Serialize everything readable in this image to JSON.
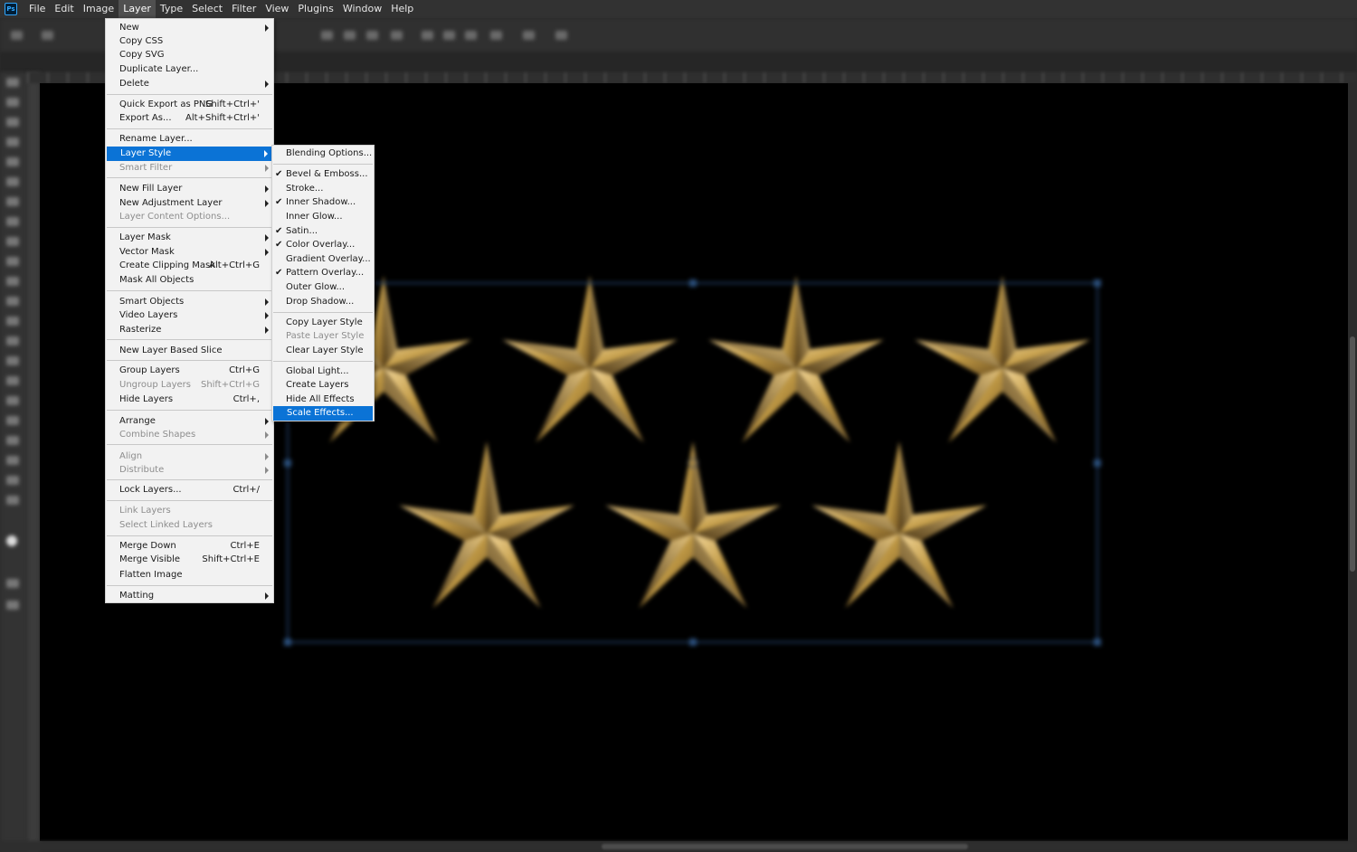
{
  "app": {
    "logo_text": "Ps"
  },
  "menubar": {
    "items": [
      "File",
      "Edit",
      "Image",
      "Layer",
      "Type",
      "Select",
      "Filter",
      "View",
      "Plugins",
      "Window",
      "Help"
    ],
    "active": "Layer"
  },
  "layer_menu": {
    "new": "New",
    "copy_css": "Copy CSS",
    "copy_svg": "Copy SVG",
    "duplicate_layer": "Duplicate Layer...",
    "delete": "Delete",
    "quick_export": "Quick Export as PNG",
    "quick_export_sc": "Shift+Ctrl+'",
    "export_as": "Export As...",
    "export_as_sc": "Alt+Shift+Ctrl+'",
    "rename_layer": "Rename Layer...",
    "layer_style": "Layer Style",
    "smart_filter": "Smart Filter",
    "new_fill_layer": "New Fill Layer",
    "new_adjustment_layer": "New Adjustment Layer",
    "layer_content_options": "Layer Content Options...",
    "layer_mask": "Layer Mask",
    "vector_mask": "Vector Mask",
    "create_clipping_mask": "Create Clipping Mask",
    "create_clipping_mask_sc": "Alt+Ctrl+G",
    "mask_all_objects": "Mask All Objects",
    "smart_objects": "Smart Objects",
    "video_layers": "Video Layers",
    "rasterize": "Rasterize",
    "new_layer_based_slice": "New Layer Based Slice",
    "group_layers": "Group Layers",
    "group_layers_sc": "Ctrl+G",
    "ungroup_layers": "Ungroup Layers",
    "ungroup_layers_sc": "Shift+Ctrl+G",
    "hide_layers": "Hide Layers",
    "hide_layers_sc": "Ctrl+,",
    "arrange": "Arrange",
    "combine_shapes": "Combine Shapes",
    "align": "Align",
    "distribute": "Distribute",
    "lock_layers": "Lock Layers...",
    "lock_layers_sc": "Ctrl+/",
    "link_layers": "Link Layers",
    "select_linked_layers": "Select Linked Layers",
    "merge_down": "Merge Down",
    "merge_down_sc": "Ctrl+E",
    "merge_visible": "Merge Visible",
    "merge_visible_sc": "Shift+Ctrl+E",
    "flatten_image": "Flatten Image",
    "matting": "Matting"
  },
  "layer_style_submenu": {
    "blending_options": "Blending Options...",
    "bevel_emboss": "Bevel & Emboss...",
    "stroke": "Stroke...",
    "inner_shadow": "Inner Shadow...",
    "inner_glow": "Inner Glow...",
    "satin": "Satin...",
    "color_overlay": "Color Overlay...",
    "gradient_overlay": "Gradient Overlay...",
    "pattern_overlay": "Pattern Overlay...",
    "outer_glow": "Outer Glow...",
    "drop_shadow": "Drop Shadow...",
    "copy_layer_style": "Copy Layer Style",
    "paste_layer_style": "Paste Layer Style",
    "clear_layer_style": "Clear Layer Style",
    "global_light": "Global Light...",
    "create_layers": "Create Layers",
    "hide_all_effects": "Hide All Effects",
    "scale_effects": "Scale Effects...",
    "checked": [
      "Bevel & Emboss...",
      "Inner Shadow...",
      "Satin...",
      "Color Overlay...",
      "Pattern Overlay..."
    ]
  },
  "canvas": {
    "background": "#000000",
    "star_color": "#c9a24c",
    "selection_color": "#1e3a5f"
  },
  "colors": {
    "menu_bg": "#f2f2f2",
    "highlight": "#0b73d6",
    "disabled_text": "#8d8d8d",
    "menubar_bg": "#323232"
  }
}
